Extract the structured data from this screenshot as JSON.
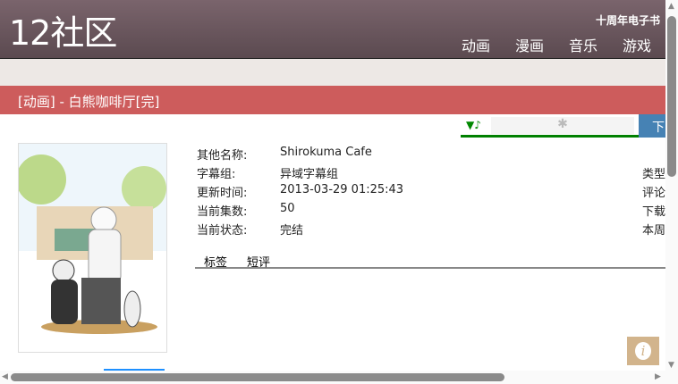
{
  "header": {
    "logo": "12社区",
    "anniversary": "十周年电子书",
    "nav": [
      "动画",
      "漫画",
      "音乐",
      "游戏"
    ]
  },
  "title": "[动画] - 白熊咖啡厅[完]",
  "toolbar": {
    "music_icon": "▼♪",
    "plugin_icon": "puzzle-icon",
    "download_label": "下载"
  },
  "info": [
    {
      "k": "其他名称:",
      "v": "Shirokuma Cafe"
    },
    {
      "k": "字幕组:",
      "v": "异域字幕组"
    },
    {
      "k": "更新时间:",
      "v": "2013-03-29 01:25:43"
    },
    {
      "k": "当前集数:",
      "v": "50"
    },
    {
      "k": "当前状态:",
      "v": "完结"
    }
  ],
  "right_labels": [
    "类型",
    "评论",
    "下载",
    "本周"
  ],
  "tabs": [
    "标签",
    "短评"
  ],
  "info_button": "i"
}
